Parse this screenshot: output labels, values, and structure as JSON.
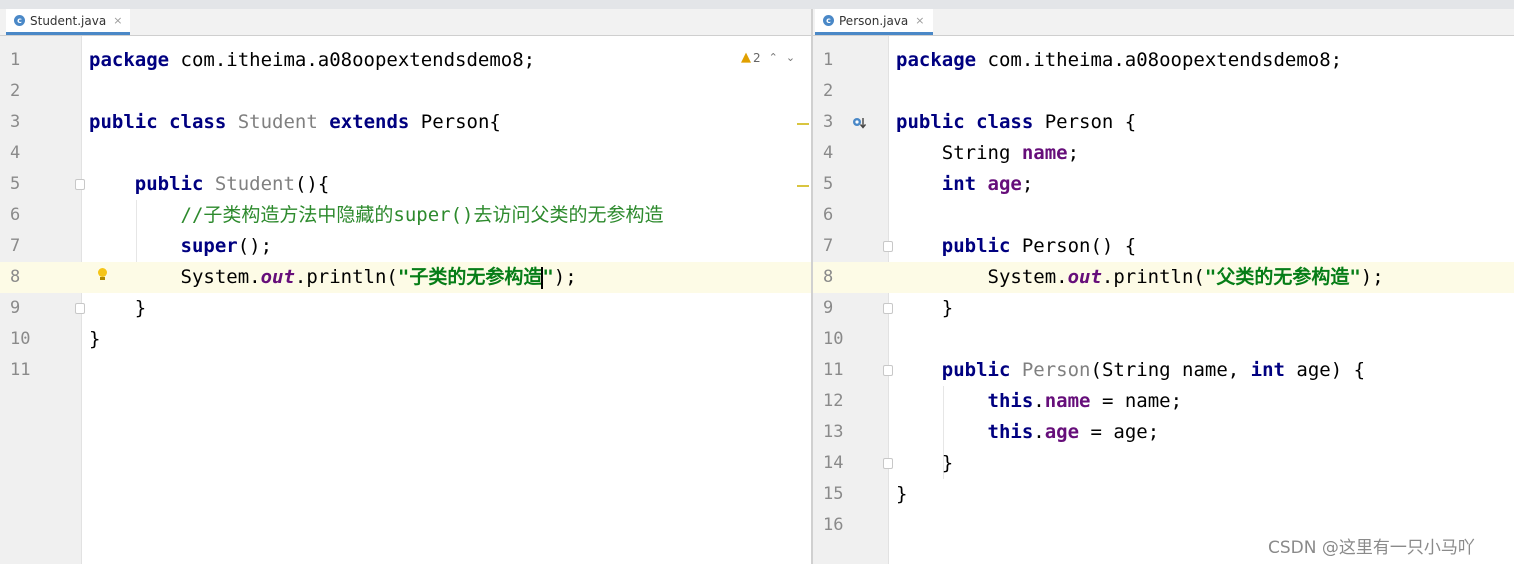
{
  "left": {
    "tab": {
      "label": "Student.java",
      "icon": "java-class-icon"
    },
    "inspections": {
      "warning_count": "2"
    },
    "lines": [
      {
        "n": "1",
        "tokens": [
          {
            "t": "package",
            "c": "kw"
          },
          {
            "t": " com.itheima.a08oopextendsdemo8;"
          }
        ]
      },
      {
        "n": "2",
        "tokens": []
      },
      {
        "n": "3",
        "tokens": [
          {
            "t": "public class",
            "c": "kw"
          },
          {
            "t": " "
          },
          {
            "t": "Student",
            "c": "gr"
          },
          {
            "t": " "
          },
          {
            "t": "extends",
            "c": "kw"
          },
          {
            "t": " Person{"
          }
        ]
      },
      {
        "n": "4",
        "tokens": []
      },
      {
        "n": "5",
        "tokens": [
          {
            "t": "    "
          },
          {
            "t": "public",
            "c": "kw"
          },
          {
            "t": " "
          },
          {
            "t": "Student",
            "c": "gr"
          },
          {
            "t": "(){"
          }
        ]
      },
      {
        "n": "6",
        "tokens": [
          {
            "t": "        "
          },
          {
            "t": "//子类构造方法中隐藏的super()去访问父类的无参构造",
            "c": "cmt"
          }
        ]
      },
      {
        "n": "7",
        "tokens": [
          {
            "t": "        "
          },
          {
            "t": "super",
            "c": "kw"
          },
          {
            "t": "();"
          }
        ]
      },
      {
        "n": "8",
        "tokens": [
          {
            "t": "        System."
          },
          {
            "t": "out",
            "c": "it"
          },
          {
            "t": ".println("
          },
          {
            "t": "\"子类的无参构造",
            "c": "str"
          },
          {
            "caret": true
          },
          {
            "t": "\"",
            "c": "str"
          },
          {
            "t": ");"
          }
        ],
        "highlight": true
      },
      {
        "n": "9",
        "tokens": [
          {
            "t": "    }"
          }
        ]
      },
      {
        "n": "10",
        "tokens": [
          {
            "t": "}"
          }
        ]
      },
      {
        "n": "11",
        "tokens": []
      }
    ]
  },
  "right": {
    "tab": {
      "label": "Person.java",
      "icon": "java-class-icon"
    },
    "lines": [
      {
        "n": "1",
        "tokens": [
          {
            "t": "package",
            "c": "kw"
          },
          {
            "t": " com.itheima.a08oopextendsdemo8;"
          }
        ]
      },
      {
        "n": "2",
        "tokens": []
      },
      {
        "n": "3",
        "tokens": [
          {
            "t": "public class",
            "c": "kw"
          },
          {
            "t": " Person {"
          }
        ]
      },
      {
        "n": "4",
        "tokens": [
          {
            "t": "    String "
          },
          {
            "t": "name",
            "c": "fld"
          },
          {
            "t": ";"
          }
        ]
      },
      {
        "n": "5",
        "tokens": [
          {
            "t": "    "
          },
          {
            "t": "int",
            "c": "kw"
          },
          {
            "t": " "
          },
          {
            "t": "age",
            "c": "fld"
          },
          {
            "t": ";"
          }
        ]
      },
      {
        "n": "6",
        "tokens": []
      },
      {
        "n": "7",
        "tokens": [
          {
            "t": "    "
          },
          {
            "t": "public",
            "c": "kw"
          },
          {
            "t": " Person() {"
          }
        ]
      },
      {
        "n": "8",
        "tokens": [
          {
            "t": "        System."
          },
          {
            "t": "out",
            "c": "it"
          },
          {
            "t": ".println("
          },
          {
            "t": "\"父类的无参构造\"",
            "c": "str"
          },
          {
            "t": ");"
          }
        ],
        "highlight": true
      },
      {
        "n": "9",
        "tokens": [
          {
            "t": "    }"
          }
        ]
      },
      {
        "n": "10",
        "tokens": []
      },
      {
        "n": "11",
        "tokens": [
          {
            "t": "    "
          },
          {
            "t": "public",
            "c": "kw"
          },
          {
            "t": " "
          },
          {
            "t": "Person",
            "c": "gr"
          },
          {
            "t": "(String name, "
          },
          {
            "t": "int",
            "c": "kw"
          },
          {
            "t": " age) {"
          }
        ]
      },
      {
        "n": "12",
        "tokens": [
          {
            "t": "        "
          },
          {
            "t": "this",
            "c": "kw"
          },
          {
            "t": "."
          },
          {
            "t": "name",
            "c": "fld"
          },
          {
            "t": " = name;"
          }
        ]
      },
      {
        "n": "13",
        "tokens": [
          {
            "t": "        "
          },
          {
            "t": "this",
            "c": "kw"
          },
          {
            "t": "."
          },
          {
            "t": "age",
            "c": "fld"
          },
          {
            "t": " = age;"
          }
        ]
      },
      {
        "n": "14",
        "tokens": [
          {
            "t": "    }"
          }
        ]
      },
      {
        "n": "15",
        "tokens": [
          {
            "t": "}"
          }
        ]
      },
      {
        "n": "16",
        "tokens": []
      }
    ]
  },
  "watermark": "CSDN @这里有一只小马吖",
  "colors": {
    "keyword": "#000080",
    "field": "#660e7a",
    "string": "#067d17",
    "comment": "#2d8a2d",
    "unused": "#808080"
  }
}
